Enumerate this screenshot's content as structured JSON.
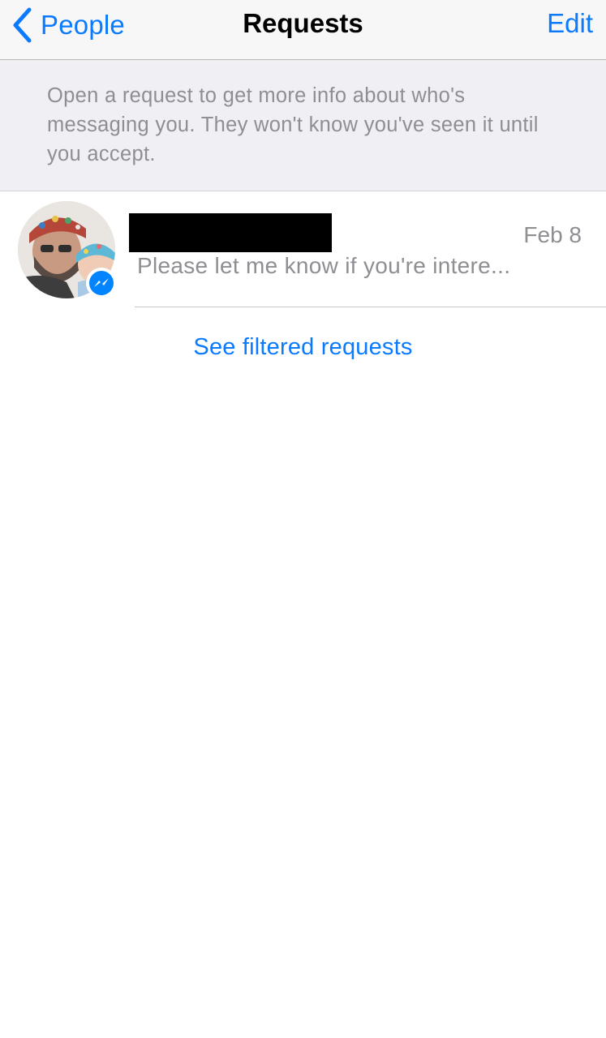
{
  "navbar": {
    "back_label": "People",
    "title": "Requests",
    "edit_label": "Edit",
    "accent_color": "#0a7aff"
  },
  "info_banner": {
    "text": "Open a request to get more info about who's messaging you. They won't know you've seen it until you accept."
  },
  "requests": [
    {
      "date": "Feb 8",
      "preview": "Please let me know if you're intere...",
      "badge_icon": "messenger-icon"
    }
  ],
  "filtered_link": "See filtered requests",
  "colors": {
    "accent": "#0a7aff",
    "secondary_text": "#8e8e93",
    "messenger_badge": "#0084ff",
    "banner_bg": "#efeff4"
  }
}
